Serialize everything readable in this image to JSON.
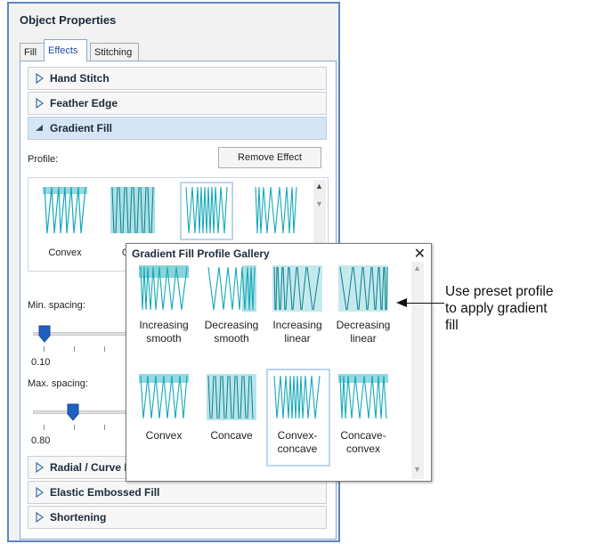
{
  "panel": {
    "title": "Object Properties",
    "tabs": [
      {
        "label": "Fill"
      },
      {
        "label": "Effects"
      },
      {
        "label": "Stitching"
      }
    ]
  },
  "sections": {
    "hand_stitch": "Hand Stitch",
    "feather_edge": "Feather Edge",
    "gradient_fill": "Gradient Fill",
    "radial_curve": "Radial / Curve Fi",
    "elastic_embossed": "Elastic Embossed Fill",
    "shortening": "Shortening"
  },
  "gradient": {
    "profile_label": "Profile:",
    "remove_button": "Remove Effect",
    "thumbs": [
      {
        "label": "Convex"
      },
      {
        "label": "Con"
      }
    ],
    "min_spacing_label": "Min. spacing:",
    "min_spacing_combo": "0",
    "min_spacing_value": "0.10",
    "max_spacing_label": "Max. spacing:",
    "max_spacing_combo": "",
    "max_spacing_value": "0.80"
  },
  "gallery": {
    "title": "Gradient Fill Profile Gallery",
    "close_glyph": "✕",
    "items": [
      {
        "line1": "Increasing",
        "line2": "smooth"
      },
      {
        "line1": "Decreasing",
        "line2": "smooth"
      },
      {
        "line1": "Increasing",
        "line2": "linear"
      },
      {
        "line1": "Decreasing",
        "line2": "linear"
      },
      {
        "line1": "Convex",
        "line2": ""
      },
      {
        "line1": "Concave",
        "line2": ""
      },
      {
        "line1": "Convex-",
        "line2": "concave"
      },
      {
        "line1": "Concave-",
        "line2": "convex"
      }
    ]
  },
  "annotation": {
    "line1": "Use preset profile",
    "line2": "to apply gradient",
    "line3": "fill"
  },
  "colors": {
    "stitch": "#14a9b8",
    "stitch_dark": "#0b7f8c",
    "accent": "#1f5fbf",
    "selection": "#bcd4ee"
  }
}
